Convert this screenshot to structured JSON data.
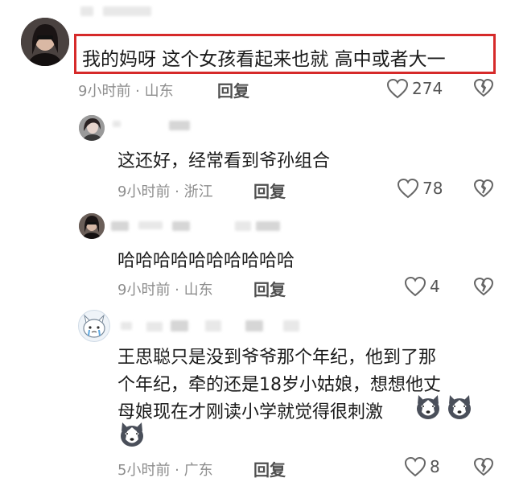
{
  "comments": [
    {
      "text": "我的妈呀 这个女孩看起来也就 高中或者大一",
      "time_location": "9小时前 · 山东",
      "reply_label": "回复",
      "likes": "274"
    },
    {
      "text": "这还好，经常看到爷孙组合",
      "time_location": "9小时前 · 浙江",
      "reply_label": "回复",
      "likes": "78"
    },
    {
      "text": "哈哈哈哈哈哈哈哈哈哈",
      "time_location": "9小时前 · 山东",
      "reply_label": "回复",
      "likes": "4"
    },
    {
      "text_lines": [
        "王思聪只是没到爷爷那个年纪，他到了那",
        "个年纪，牵的还是18岁小姑娘，想想他丈",
        "母娘现在才刚读小学就觉得很刺激"
      ],
      "time_location": "5小时前 · 广东",
      "reply_label": "回复",
      "likes": "8"
    }
  ],
  "icons": {
    "like": "heart-outline-icon",
    "dislike": "broken-heart-icon",
    "emoji": "husky-dog-emoji-icon"
  }
}
